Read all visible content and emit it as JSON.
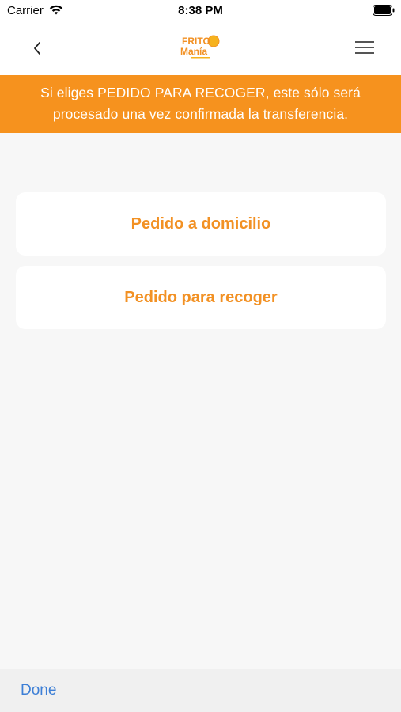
{
  "status_bar": {
    "carrier": "Carrier",
    "time": "8:38 PM",
    "icons": [
      "wifi-icon",
      "battery-icon"
    ]
  },
  "nav": {
    "back_icon": "chevron-left-icon",
    "logo_text_line1": "FRITO",
    "logo_text_line2": "Manía",
    "menu_icon": "hamburger-menu-icon"
  },
  "banner": {
    "line1": "Si eliges PEDIDO PARA RECOGER, este sólo será",
    "line2": "procesado una vez confirmada la transferencia."
  },
  "options": {
    "delivery_label": "Pedido a domicilio",
    "pickup_label": "Pedido para recoger"
  },
  "toolbar": {
    "done_label": "Done"
  },
  "colors": {
    "accent": "#f6921e",
    "option_text": "#f29124",
    "link": "#3d7fd6",
    "background": "#f7f7f7"
  }
}
